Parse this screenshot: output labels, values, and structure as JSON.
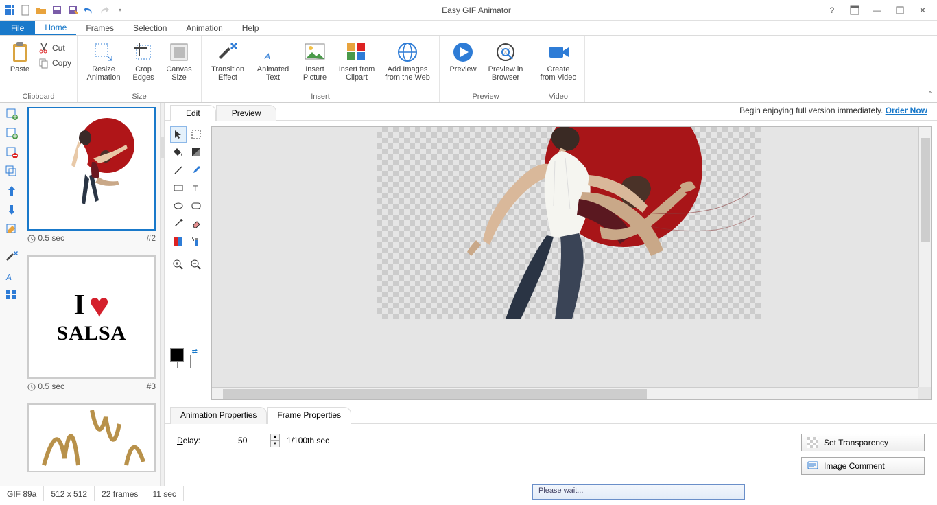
{
  "title": "Easy GIF Animator",
  "menus": {
    "file": "File",
    "home": "Home",
    "frames": "Frames",
    "selection": "Selection",
    "animation": "Animation",
    "help": "Help"
  },
  "ribbon": {
    "clipboard": {
      "label": "Clipboard",
      "paste": "Paste",
      "cut": "Cut",
      "copy": "Copy"
    },
    "size": {
      "label": "Size",
      "resize": "Resize\nAnimation",
      "crop": "Crop\nEdges",
      "canvas": "Canvas\nSize"
    },
    "insert": {
      "label": "Insert",
      "transition": "Transition\nEffect",
      "animtext": "Animated\nText",
      "picture": "Insert\nPicture",
      "clipart": "Insert from\nClipart",
      "web": "Add Images\nfrom the Web"
    },
    "preview": {
      "label": "Preview",
      "preview": "Preview",
      "browser": "Preview in\nBrowser"
    },
    "video": {
      "label": "Video",
      "create": "Create\nfrom Video"
    }
  },
  "edit_tabs": {
    "edit": "Edit",
    "preview": "Preview"
  },
  "promo": {
    "text": "Begin enjoying full version immediately. ",
    "link": "Order Now"
  },
  "frames": [
    {
      "duration": "0.5 sec",
      "index": "#2"
    },
    {
      "duration": "0.5 sec",
      "index": "#3"
    }
  ],
  "salsa_text": {
    "i": "I",
    "salsa": "SALSA"
  },
  "bottom_tabs": {
    "anim": "Animation Properties",
    "frame": "Frame Properties"
  },
  "delay": {
    "label": "Delay:",
    "value": "50",
    "unit": "1/100th sec"
  },
  "buttons": {
    "transparency": "Set Transparency",
    "comment": "Image Comment"
  },
  "status": {
    "format": "GIF 89a",
    "dims": "512 x 512",
    "framecount": "22 frames",
    "duration": "11 sec"
  },
  "please_wait": "Please wait..."
}
